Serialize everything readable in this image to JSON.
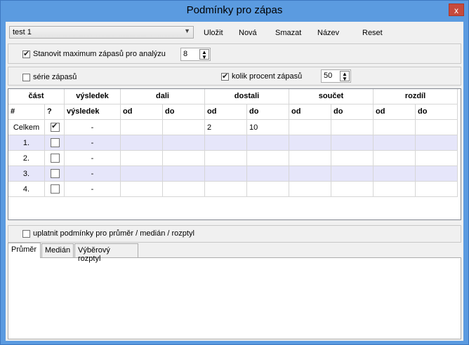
{
  "window": {
    "title": "Podmínky pro zápas",
    "close_label": "x"
  },
  "toolbar": {
    "combo_value": "test 1",
    "save_label": "Uložit",
    "new_label": "Nová",
    "delete_label": "Smazat",
    "name_label": "Název",
    "reset_label": "Reset"
  },
  "options": {
    "max_matches_label": "Stanovit maximum zápasů pro analýzu",
    "max_matches_checked": true,
    "max_matches_value": "8",
    "series_label": "série zápasů",
    "series_checked": false,
    "percent_label": "kolik procent zápasů",
    "percent_checked": true,
    "percent_value": "50"
  },
  "grid": {
    "group_headers": [
      "část",
      "výsledek",
      "dali",
      "dostali",
      "součet",
      "rozdíl"
    ],
    "sub_headers": [
      "#",
      "?",
      "výsledek",
      "od",
      "do",
      "od",
      "do",
      "od",
      "do",
      "od",
      "do"
    ],
    "rows": [
      {
        "label": "Celkem",
        "checked": true,
        "result": "-",
        "values": [
          "",
          "",
          "2",
          "10",
          "",
          "",
          "",
          ""
        ]
      },
      {
        "label": "1.",
        "checked": false,
        "result": "-",
        "values": [
          "",
          "",
          "",
          "",
          "",
          "",
          "",
          ""
        ]
      },
      {
        "label": "2.",
        "checked": false,
        "result": "-",
        "values": [
          "",
          "",
          "",
          "",
          "",
          "",
          "",
          ""
        ]
      },
      {
        "label": "3.",
        "checked": false,
        "result": "-",
        "values": [
          "",
          "",
          "",
          "",
          "",
          "",
          "",
          ""
        ]
      },
      {
        "label": "4.",
        "checked": false,
        "result": "-",
        "values": [
          "",
          "",
          "",
          "",
          "",
          "",
          "",
          ""
        ]
      }
    ]
  },
  "stats": {
    "apply_label": "uplatnit podmínky pro průměr / medián / rozptyl",
    "apply_checked": false,
    "tabs": [
      "Průměr",
      "Medián",
      "Výběrový rozptyl"
    ],
    "active_tab": 0
  }
}
